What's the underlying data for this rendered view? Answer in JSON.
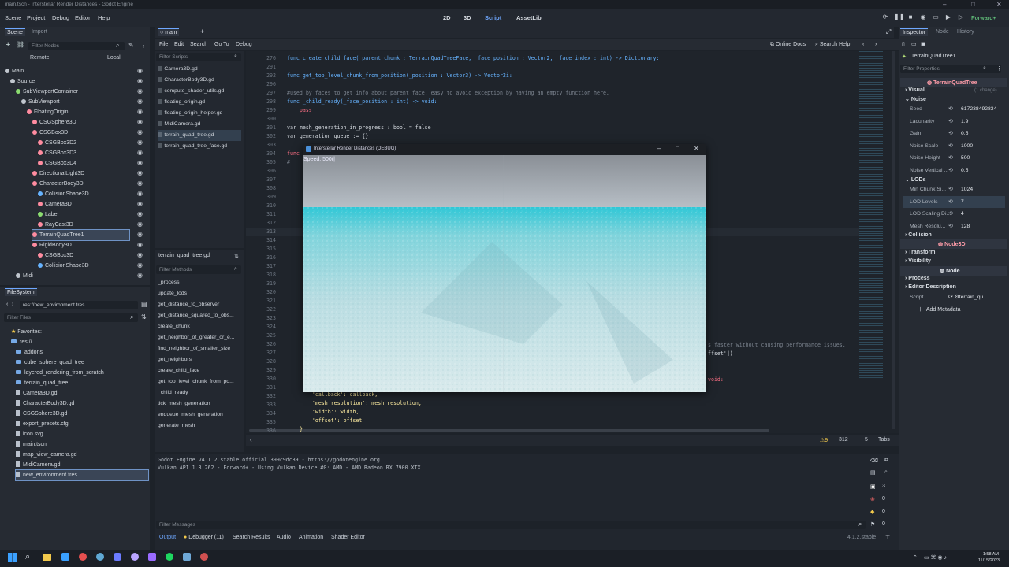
{
  "window": {
    "title": "main.tscn - Interstellar Render Distances - Godot Engine"
  },
  "menu": {
    "items": [
      "Scene",
      "Project",
      "Debug",
      "Editor",
      "Help"
    ]
  },
  "workspace": {
    "tabs": [
      "2D",
      "3D",
      "Script",
      "AssetLib"
    ],
    "active": "Script"
  },
  "renderer": {
    "label": "Forward+"
  },
  "scene_dock": {
    "tabs": [
      "Scene",
      "Import"
    ],
    "filter_placeholder": "Filter Nodes",
    "remote": "Remote",
    "local": "Local",
    "nodes": [
      "Main",
      "Source",
      "SubViewportContainer",
      "SubViewport",
      "FloatingOrigin",
      "CSGSphere3D",
      "CSGBox3D",
      "CSGBox3D2",
      "CSGBox3D3",
      "CSGBox3D4",
      "DirectionalLight3D",
      "CharacterBody3D",
      "CollisionShape3D",
      "Camera3D",
      "Label",
      "RayCast3D",
      "TerrainQuadTree1",
      "RigidBody3D",
      "CSGBox3D",
      "CollisionShape3D",
      "Midi"
    ]
  },
  "filesystem": {
    "tab": "FileSystem",
    "path": "res://new_environment.tres",
    "filter_placeholder": "Filter Files",
    "favorites": "Favorites:",
    "root": "res://",
    "items": [
      "addons",
      "cube_sphere_quad_tree",
      "layered_rendering_from_scratch",
      "terrain_quad_tree",
      "Camera3D.gd",
      "CharacterBody3D.gd",
      "CSGSphere3D.gd",
      "export_presets.cfg",
      "icon.svg",
      "main.tscn",
      "map_view_camera.gd",
      "MidiCamera.gd",
      "new_environment.tres"
    ]
  },
  "script_editor": {
    "tab": "main",
    "menu": [
      "File",
      "Edit",
      "Search",
      "Go To",
      "Debug"
    ],
    "online_docs": "Online Docs",
    "search_help": "Search Help",
    "filter_scripts": "Filter Scripts",
    "scripts": [
      "Camera3D.gd",
      "CharacterBody3D.gd",
      "compute_shader_utils.gd",
      "floating_origin.gd",
      "floating_origin_helper.gd",
      "MidiCamera.gd",
      "terrain_quad_tree.gd",
      "terrain_quad_tree_face.gd"
    ],
    "current_script": "terrain_quad_tree.gd",
    "filter_methods": "Filter Methods",
    "methods": [
      "_process",
      "update_lods",
      "get_distance_to_observer",
      "get_distance_squared_to_obs...",
      "create_chunk",
      "get_neighbor_of_greater_or_e...",
      "find_neighbor_of_smaller_size",
      "get_neighbors",
      "create_child_face",
      "get_top_level_chunk_from_po...",
      "_child_ready",
      "tick_mesh_generation",
      "enqueue_mesh_generation",
      "generate_mesh"
    ],
    "line_numbers": [
      "276",
      "291",
      "292",
      "296",
      "297",
      "298",
      "299",
      "300",
      "301",
      "302",
      "303",
      "304",
      "305",
      "306",
      "307",
      "308",
      "309",
      "310",
      "311",
      "312",
      "313",
      "314",
      "315",
      "316",
      "317",
      "318",
      "319",
      "320",
      "321",
      "322",
      "323",
      "324",
      "325",
      "326",
      "327",
      "328",
      "329",
      "330",
      "331",
      "332",
      "333",
      "334",
      "335",
      "336"
    ],
    "code_lines": [
      "func create_child_face(_parent_chunk : TerrainQuadTreeFace, _face_position : Vector2, _face_index : int) -> Dictionary:",
      "",
      "func get_top_level_chunk_from_position(_position : Vector3) -> Vector2i:",
      "",
      "#used by faces to get info about parent face, easy to avoid exception by having an empty function here.",
      "func _child_ready(_face_position : int) -> void:",
      "    pass",
      "",
      "var mesh_generation_in_progress : bool = false",
      "var generation_queue := {}",
      "",
      "func",
      "#"
    ],
    "code_tail": [
      "    'callback': callback,",
      "    'mesh_resolution': mesh_resolution,",
      "    'width': width,",
      "    'offset': offset",
      "}"
    ],
    "code_right_1": "s faster without causing performance issues.",
    "code_right_2": "ffset'])",
    "code_right_3": "void:",
    "status_warnings": "9",
    "status_line": "312",
    "status_col": "5",
    "status_tabs": "Tabs"
  },
  "game_window": {
    "title": "Interstellar Render Distances (DEBUG)",
    "overlay": "Speed: 500(|"
  },
  "output": {
    "lines": [
      "Godot Engine v4.1.2.stable.official.399c9dc39 - https://godotengine.org",
      "Vulkan API 1.3.262 - Forward+ - Using Vulkan Device #0: AMD - AMD Radeon RX 7900 XTX"
    ],
    "filter_placeholder": "Filter Messages",
    "counts": [
      "3",
      "0",
      "0",
      "0"
    ],
    "tabs": [
      "Output",
      "Debugger (11)",
      "Search Results",
      "Audio",
      "Animation",
      "Shader Editor"
    ],
    "version": "4.1.2.stable"
  },
  "inspector": {
    "tabs": [
      "Inspector",
      "Node",
      "History"
    ],
    "object": "TerrainQuadTree1",
    "filter_placeholder": "Filter Properties",
    "header": "TerrainQuadTree",
    "sections": {
      "visual": "Visual",
      "noise": "Noise",
      "lods": "LODs",
      "collision": "Collision",
      "node3d": "Node3D",
      "transform": "Transform",
      "visibility": "Visibility",
      "node": "Node",
      "process": "Process",
      "editor_description": "Editor Description"
    },
    "changes": "(1 change)",
    "noise_props": [
      {
        "label": "Seed",
        "value": "617238492834"
      },
      {
        "label": "Lacunarity",
        "value": "1.9"
      },
      {
        "label": "Gain",
        "value": "0.5"
      },
      {
        "label": "Noise Scale",
        "value": "1000"
      },
      {
        "label": "Noise Height",
        "value": "500"
      },
      {
        "label": "Noise Vertical ...",
        "value": "0.5"
      }
    ],
    "lod_props": [
      {
        "label": "Min Chunk Si...",
        "value": "1024"
      },
      {
        "label": "LOD Levels",
        "value": "7"
      },
      {
        "label": "LOD Scaling Di...",
        "value": "4"
      },
      {
        "label": "Mesh Resolu...",
        "value": "128"
      }
    ],
    "script_label": "Script",
    "script_value": "terrain_qu",
    "add_metadata": "Add Metadata"
  },
  "taskbar": {
    "time": "1:58 AM",
    "date": "11/15/2023"
  }
}
